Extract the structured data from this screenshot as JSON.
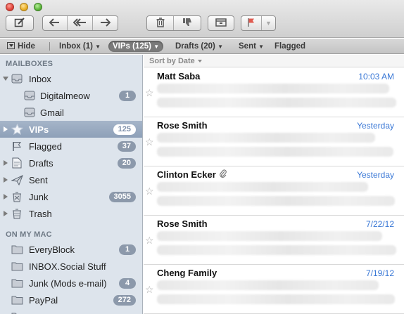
{
  "toolbar": {
    "buttons": [
      {
        "name": "compose",
        "icon": "compose-icon",
        "glyph": "✎"
      },
      {
        "name": "reply",
        "icon": "reply-icon",
        "glyph": "↩"
      },
      {
        "name": "reply-all",
        "icon": "reply-all-icon",
        "glyph": "⇇"
      },
      {
        "name": "forward",
        "icon": "forward-icon",
        "glyph": "➜"
      },
      {
        "name": "delete",
        "icon": "trash-icon",
        "glyph": "🗑"
      },
      {
        "name": "junk",
        "icon": "thumbs-down-icon",
        "glyph": "👎"
      },
      {
        "name": "archive",
        "icon": "archive-icon",
        "glyph": "▭"
      },
      {
        "name": "flag",
        "icon": "flag-icon",
        "glyph": "⚑"
      },
      {
        "name": "flag-menu",
        "icon": "chevron-down-icon",
        "glyph": "▾"
      }
    ]
  },
  "favorites": {
    "hide_label": "Hide",
    "inbox_label": "Inbox (1)",
    "vips_label": "VIPs (125)",
    "drafts_label": "Drafts (20)",
    "sent_label": "Sent",
    "flagged_label": "Flagged"
  },
  "sidebar": {
    "mailboxes_header": "MAILBOXES",
    "on_my_mac_header": "ON MY MAC",
    "items": [
      {
        "label": "Inbox",
        "badge": ""
      },
      {
        "label": "Digitalmeow",
        "badge": "1"
      },
      {
        "label": "Gmail",
        "badge": ""
      },
      {
        "label": "VIPs",
        "badge": "125"
      },
      {
        "label": "Flagged",
        "badge": "37"
      },
      {
        "label": "Drafts",
        "badge": "20"
      },
      {
        "label": "Sent",
        "badge": ""
      },
      {
        "label": "Junk",
        "badge": "3055"
      },
      {
        "label": "Trash",
        "badge": ""
      }
    ],
    "local": [
      {
        "label": "EveryBlock",
        "badge": "1"
      },
      {
        "label": "INBOX.Social Stuff",
        "badge": ""
      },
      {
        "label": "Junk (Mods e-mail)",
        "badge": "4"
      },
      {
        "label": "PayPal",
        "badge": "272"
      }
    ],
    "colors": {
      "background": "#dde4ec",
      "selection": "#8ea0b8",
      "badge": "#8c99ab"
    }
  },
  "list": {
    "sort_label": "Sort by Date",
    "messages": [
      {
        "sender": "Matt Saba",
        "date": "10:03 AM"
      },
      {
        "sender": "Rose Smith",
        "date": "Yesterday"
      },
      {
        "sender": "Clinton Ecker",
        "date": "Yesterday",
        "attachment": "paperclip-icon"
      },
      {
        "sender": "Rose Smith",
        "date": "7/22/12"
      },
      {
        "sender": "Cheng Family",
        "date": "7/19/12"
      }
    ],
    "colors": {
      "date": "#3a78d6"
    }
  }
}
